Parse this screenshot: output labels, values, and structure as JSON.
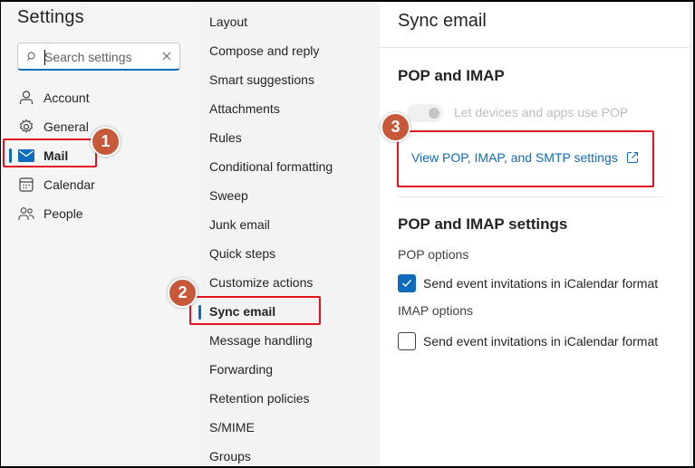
{
  "settings": {
    "title": "Settings",
    "search": {
      "placeholder": "Search settings",
      "value": ""
    }
  },
  "nav": {
    "items": [
      {
        "label": "Account",
        "icon": "person-icon",
        "active": false
      },
      {
        "label": "General",
        "icon": "gear-icon",
        "active": false
      },
      {
        "label": "Mail",
        "icon": "mail-icon",
        "active": true
      },
      {
        "label": "Calendar",
        "icon": "calendar-icon",
        "active": false
      },
      {
        "label": "People",
        "icon": "people-icon",
        "active": false
      }
    ]
  },
  "mail_nav": {
    "items": [
      {
        "label": "Layout",
        "active": false
      },
      {
        "label": "Compose and reply",
        "active": false
      },
      {
        "label": "Smart suggestions",
        "active": false
      },
      {
        "label": "Attachments",
        "active": false
      },
      {
        "label": "Rules",
        "active": false
      },
      {
        "label": "Conditional formatting",
        "active": false
      },
      {
        "label": "Sweep",
        "active": false
      },
      {
        "label": "Junk email",
        "active": false
      },
      {
        "label": "Quick steps",
        "active": false
      },
      {
        "label": "Customize actions",
        "active": false
      },
      {
        "label": "Sync email",
        "active": true
      },
      {
        "label": "Message handling",
        "active": false
      },
      {
        "label": "Forwarding",
        "active": false
      },
      {
        "label": "Retention policies",
        "active": false
      },
      {
        "label": "S/MIME",
        "active": false
      },
      {
        "label": "Groups",
        "active": false
      }
    ]
  },
  "content": {
    "title": "Sync email",
    "pop_imap": {
      "heading": "POP and IMAP",
      "toggle_label": "Let devices and apps use POP",
      "toggle_on": false,
      "toggle_disabled": true,
      "link_label": "View POP, IMAP, and SMTP settings",
      "link_icon": "open-external-icon"
    },
    "pop_imap_settings": {
      "heading": "POP and IMAP settings",
      "pop_options_label": "POP options",
      "pop_checkbox_label": "Send event invitations in iCalendar format",
      "pop_checkbox_checked": true,
      "imap_options_label": "IMAP options",
      "imap_checkbox_label": "Send event invitations in iCalendar format",
      "imap_checkbox_checked": false
    }
  },
  "annotations": {
    "badges": [
      "1",
      "2",
      "3"
    ],
    "highlight_color": "#e0141e",
    "badge_color": "#c8583a"
  },
  "colors": {
    "accent": "#0f6cbd",
    "link": "#0f6cbd",
    "text": "#242424"
  }
}
